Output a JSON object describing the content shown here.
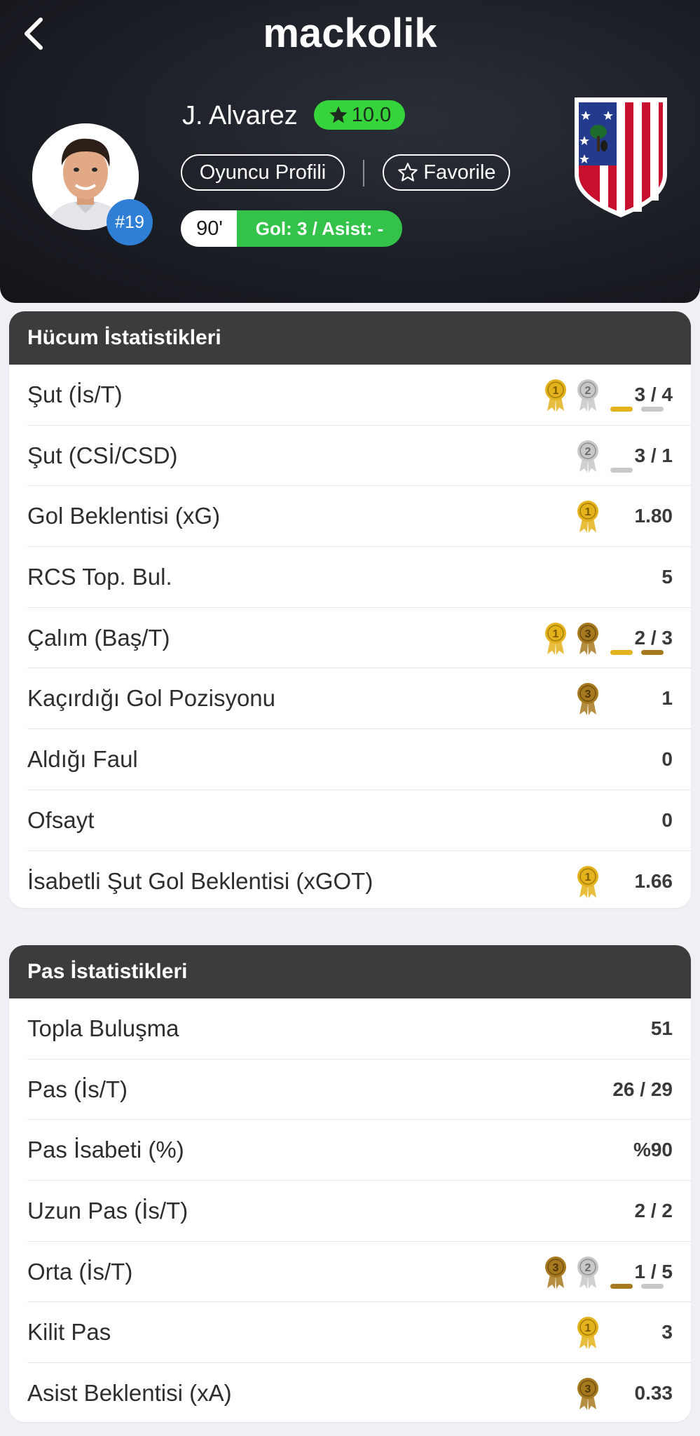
{
  "app": {
    "brand": "mackolik"
  },
  "player": {
    "name": "J. Alvarez",
    "rating": "10.0",
    "jersey": "#19",
    "minutes": "90'",
    "goals_assists": "Gol: 3 / Asist: -",
    "profile_button": "Oyuncu Profili",
    "favorite_button": "Favorile"
  },
  "colors": {
    "gold": "#e3b21c",
    "silver": "#c8c8c8",
    "bronze": "#a7791e",
    "rating_green": "#35d43a",
    "goals_green": "#33c24a",
    "jersey_blue": "#2f7fd6"
  },
  "sections": {
    "attack": {
      "title": "Hücum İstatistikleri",
      "rows": [
        {
          "label": "Şut (İs/T)",
          "value": "3 / 4",
          "medals": [
            "gold",
            "silver"
          ],
          "bars": [
            "gold",
            "silver"
          ]
        },
        {
          "label": "Şut (CSİ/CSD)",
          "value": "3 / 1",
          "medals": [
            "silver"
          ],
          "bars": [
            "silver"
          ]
        },
        {
          "label": "Gol Beklentisi (xG)",
          "value": "1.80",
          "medals": [
            "gold"
          ],
          "bars": []
        },
        {
          "label": "RCS Top. Bul.",
          "value": "5",
          "medals": [],
          "bars": []
        },
        {
          "label": "Çalım (Baş/T)",
          "value": "2 / 3",
          "medals": [
            "gold",
            "bronze"
          ],
          "bars": [
            "gold",
            "bronze"
          ]
        },
        {
          "label": "Kaçırdığı Gol Pozisyonu",
          "value": "1",
          "medals": [
            "bronze"
          ],
          "bars": []
        },
        {
          "label": "Aldığı Faul",
          "value": "0",
          "medals": [],
          "bars": []
        },
        {
          "label": "Ofsayt",
          "value": "0",
          "medals": [],
          "bars": []
        },
        {
          "label": "İsabetli Şut Gol Beklentisi (xGOT)",
          "value": "1.66",
          "medals": [
            "gold"
          ],
          "bars": []
        }
      ]
    },
    "pass": {
      "title": "Pas İstatistikleri",
      "rows": [
        {
          "label": "Topla Buluşma",
          "value": "51",
          "medals": [],
          "bars": []
        },
        {
          "label": "Pas (İs/T)",
          "value": "26 / 29",
          "medals": [],
          "bars": []
        },
        {
          "label": "Pas İsabeti (%)",
          "value": "%90",
          "medals": [],
          "bars": []
        },
        {
          "label": "Uzun Pas (İs/T)",
          "value": "2 / 2",
          "medals": [],
          "bars": []
        },
        {
          "label": "Orta (İs/T)",
          "value": "1 / 5",
          "medals": [
            "bronze",
            "silver"
          ],
          "bars": [
            "bronze",
            "silver"
          ]
        },
        {
          "label": "Kilit Pas",
          "value": "3",
          "medals": [
            "gold"
          ],
          "bars": []
        },
        {
          "label": "Asist Beklentisi (xA)",
          "value": "0.33",
          "medals": [
            "bronze"
          ],
          "bars": []
        }
      ]
    }
  }
}
